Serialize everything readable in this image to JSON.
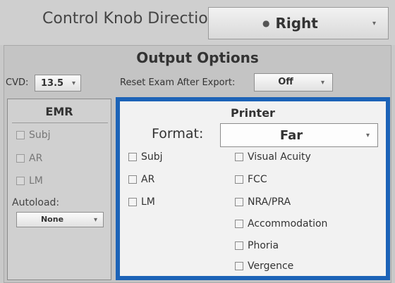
{
  "header": {
    "control_knob_label": "Control Knob Direction:",
    "control_knob_value": "Right"
  },
  "output_options": {
    "title": "Output Options",
    "cvd_label": "CVD:",
    "cvd_value": "13.5",
    "reset_label": "Reset Exam After Export:",
    "reset_value": "Off"
  },
  "emr": {
    "title": "EMR",
    "items": [
      "Subj",
      "AR",
      "LM"
    ],
    "autoload_label": "Autoload:",
    "autoload_value": "None"
  },
  "printer": {
    "title": "Printer",
    "format_label": "Format:",
    "format_value": "Far",
    "left_items": [
      "Subj",
      "AR",
      "LM"
    ],
    "right_items": [
      "Visual Acuity",
      "FCC",
      "NRA/PRA",
      "Accommodation",
      "Phoria",
      "Vergence"
    ]
  },
  "colors": {
    "highlight_border": "#1c63b7",
    "panel_background": "#c4c4c4",
    "printer_background": "#f2f2f2"
  }
}
